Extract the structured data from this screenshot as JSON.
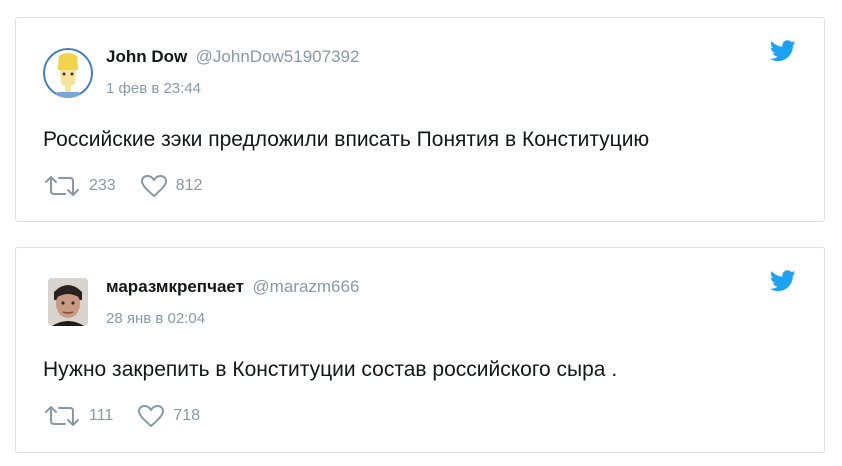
{
  "tweets": [
    {
      "name": "John Dow",
      "handle": "@JohnDow51907392",
      "date": "1 фев в 23:44",
      "text": "Российские зэки предложили вписать Понятия в Конституцию",
      "retweets": "233",
      "likes": "812",
      "avatar_icon": "cartoon-character-avatar"
    },
    {
      "name": "маразмкрепчает",
      "handle": "@marazm666",
      "date": "28 янв в 02:04",
      "text": "Нужно закрепить в Конституции состав российского сыра .",
      "retweets": "111",
      "likes": "718",
      "avatar_icon": "photo-face-avatar"
    }
  ],
  "colors": {
    "twitter_blue": "#1da1f2",
    "muted": "#8899a6",
    "text": "#14171a",
    "border": "#e1e1e1"
  }
}
